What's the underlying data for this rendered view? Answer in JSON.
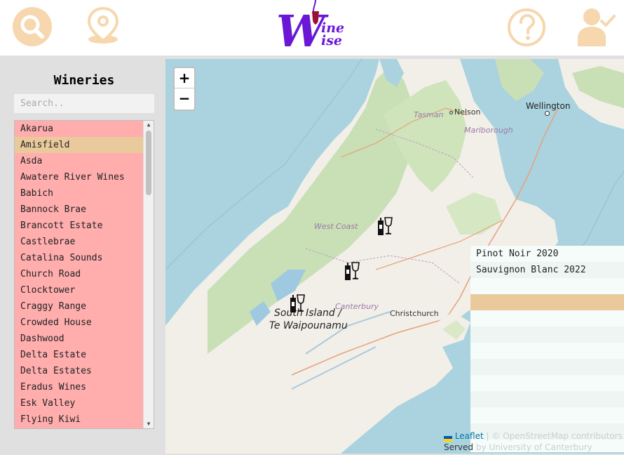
{
  "header": {
    "logo_top": "W",
    "logo_line1": "ine",
    "logo_line2": "ise",
    "colors": {
      "icon_fill": "#f6d7ae",
      "logo_purple": "#6a17d6",
      "logo_wine": "#9a1131"
    },
    "icons": [
      "search-icon",
      "location-pin-icon",
      "help-icon",
      "user-check-icon"
    ]
  },
  "sidebar": {
    "title": "Wineries",
    "search_placeholder": "Search..",
    "items": [
      {
        "label": "Akarua",
        "selected": false
      },
      {
        "label": "Amisfield",
        "selected": true
      },
      {
        "label": "Asda",
        "selected": false
      },
      {
        "label": "Awatere River Wines",
        "selected": false
      },
      {
        "label": "Babich",
        "selected": false
      },
      {
        "label": "Bannock Brae",
        "selected": false
      },
      {
        "label": "Brancott Estate",
        "selected": false
      },
      {
        "label": "Castlebrae",
        "selected": false
      },
      {
        "label": "Catalina Sounds",
        "selected": false
      },
      {
        "label": "Church Road",
        "selected": false
      },
      {
        "label": "Clocktower",
        "selected": false
      },
      {
        "label": "Craggy Range",
        "selected": false
      },
      {
        "label": "Crowded House",
        "selected": false
      },
      {
        "label": "Dashwood",
        "selected": false
      },
      {
        "label": "Delta Estate",
        "selected": false
      },
      {
        "label": "Delta Estates",
        "selected": false
      },
      {
        "label": "Eradus Wines",
        "selected": false
      },
      {
        "label": "Esk Valley",
        "selected": false
      },
      {
        "label": "Flying Kiwi",
        "selected": false
      }
    ],
    "colors": {
      "list_bg": "#ffadad",
      "selected_bg": "#eaca9d"
    }
  },
  "map": {
    "zoom_in": "+",
    "zoom_out": "−",
    "labels": {
      "tasman": "Tasman",
      "nelson": "Nelson",
      "marlborough": "Marlborough",
      "wellington": "Wellington",
      "west_coast": "West Coast",
      "canterbury": "Canterbury",
      "christchurch": "Christchurch",
      "island_line1": "South Island /",
      "island_line2": "Te Waipounamu"
    },
    "markers": [
      "wine-marker-icon",
      "wine-marker-icon",
      "wine-marker-icon"
    ],
    "attribution": {
      "leaflet": "Leaflet",
      "osm": "| © OpenStreetMap contributors",
      "served_prefix": "Served",
      "served_rest": "by University of Canterbury"
    },
    "colors": {
      "water": "#aad3df",
      "land": "#f2efe9",
      "forest": "#c9dfb5"
    }
  },
  "wine_panel": {
    "rows": [
      {
        "label": "Pinot Noir 2020",
        "selected": false
      },
      {
        "label": "Sauvignon Blanc 2022",
        "selected": false
      },
      {
        "label": "",
        "selected": false
      },
      {
        "label": "",
        "selected": true
      },
      {
        "label": "",
        "selected": false
      },
      {
        "label": "",
        "selected": false
      },
      {
        "label": "",
        "selected": false
      },
      {
        "label": "",
        "selected": false
      },
      {
        "label": "",
        "selected": false
      },
      {
        "label": "",
        "selected": false
      },
      {
        "label": "",
        "selected": false
      },
      {
        "label": "",
        "selected": false
      }
    ]
  }
}
